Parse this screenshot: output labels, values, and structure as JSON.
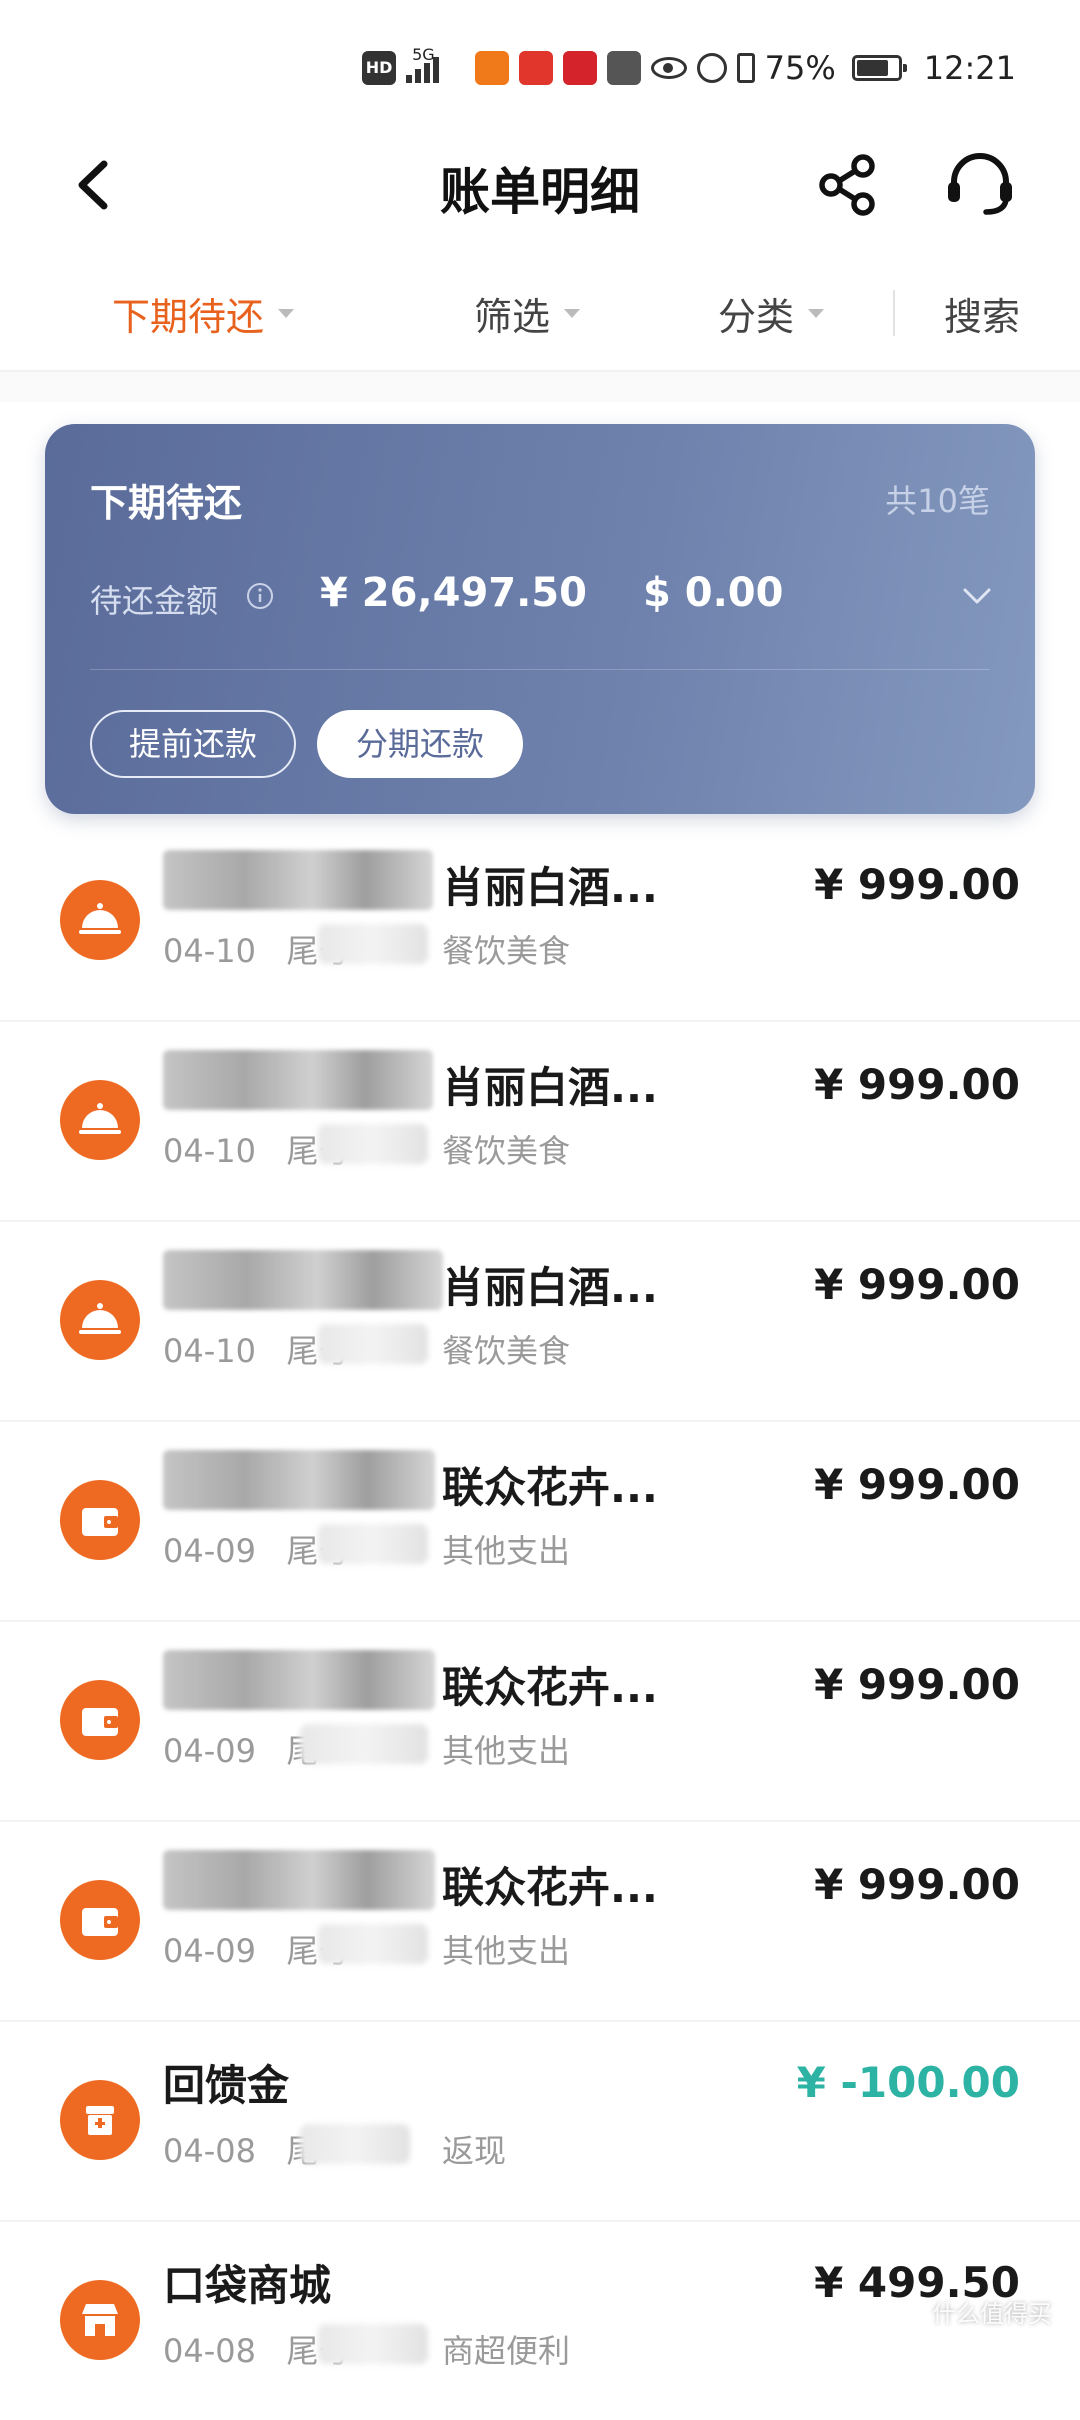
{
  "status_bar": {
    "network": "5G",
    "battery_percent": "75%",
    "time": "12:21"
  },
  "header": {
    "title": "账单明细"
  },
  "filters": {
    "period": "下期待还",
    "filter": "筛选",
    "category": "分类",
    "search": "搜索"
  },
  "summary": {
    "title": "下期待还",
    "count": "共10笔",
    "amount_label": "待还金额",
    "amount_cny": "¥ 26,497.50",
    "amount_usd": "$ 0.00",
    "btn_prepay": "提前还款",
    "btn_installment": "分期还款"
  },
  "transactions": [
    {
      "icon": "dining-icon",
      "name": "肖丽白酒...",
      "date": "04-10",
      "card": "尾号",
      "category": "餐饮美食",
      "amount": "¥ 999.00"
    },
    {
      "icon": "dining-icon",
      "name": "肖丽白酒...",
      "date": "04-10",
      "card": "尾号",
      "category": "餐饮美食",
      "amount": "¥ 999.00"
    },
    {
      "icon": "dining-icon",
      "name": "肖丽白酒...",
      "date": "04-10",
      "card": "尾号",
      "category": "餐饮美食",
      "amount": "¥ 999.00"
    },
    {
      "icon": "wallet-icon",
      "name": "联众花卉...",
      "date": "04-09",
      "card": "尾号",
      "category": "其他支出",
      "amount": "¥ 999.00"
    },
    {
      "icon": "wallet-icon",
      "name": "联众花卉...",
      "date": "04-09",
      "card": "尾",
      "category": "其他支出",
      "amount": "¥ 999.00"
    },
    {
      "icon": "wallet-icon",
      "name": "联众花卉...",
      "date": "04-09",
      "card": "尾号",
      "category": "其他支出",
      "amount": "¥ 999.00"
    },
    {
      "icon": "gift-box-icon",
      "name": "回馈金",
      "date": "04-08",
      "card": "尾",
      "category": "返现",
      "amount": "¥ -100.00"
    },
    {
      "icon": "store-icon",
      "name": "口袋商城",
      "date": "04-08",
      "card": "尾号",
      "category": "商超便利",
      "amount": "¥ 499.50"
    }
  ],
  "watermark": "什么值得买",
  "colors": {
    "accent": "#ee6a22",
    "active_filter": "#e8621e",
    "card_gradient_start": "#5a6b9a",
    "card_gradient_end": "#8499bf",
    "refund": "#2cb3a4"
  }
}
